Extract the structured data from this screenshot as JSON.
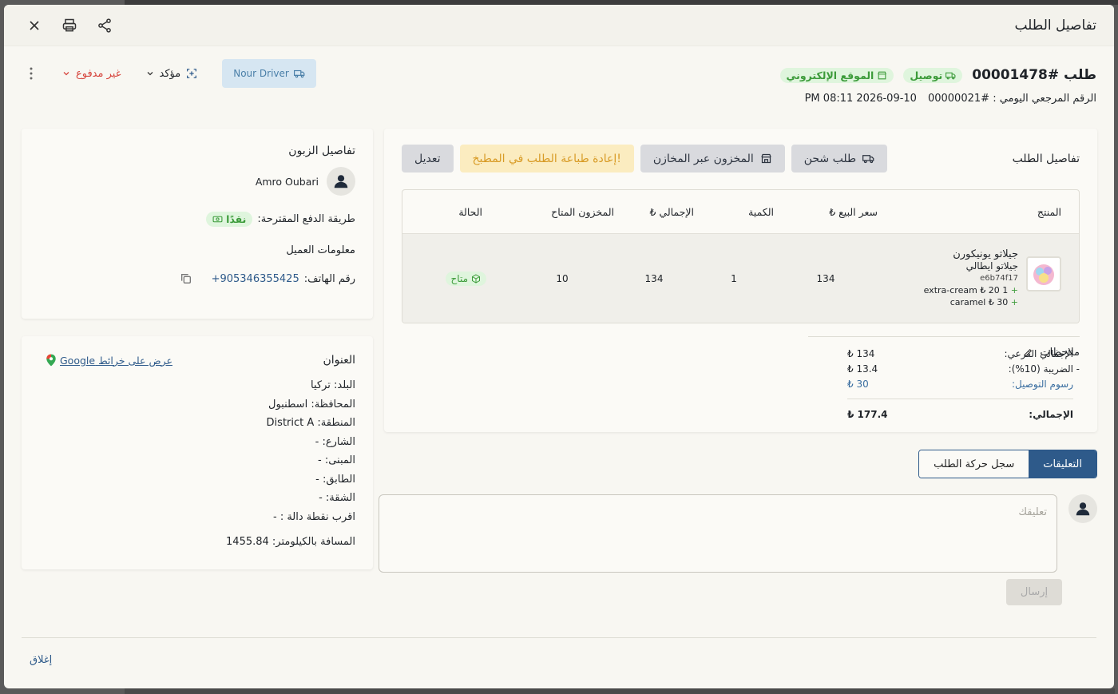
{
  "modal": {
    "title": "تفاصيل الطلب"
  },
  "order": {
    "number": "طلب #00001478",
    "badge_delivery": "توصيل",
    "badge_source": "الموقع الإلكتروني",
    "daily_ref_label": "الرقم المرجعي اليومي :",
    "daily_ref_value": "#00000021",
    "datetime": "2026-09-10 08:11 PM",
    "driver": "Nour Driver",
    "status": "مؤكد",
    "payment_status": "غير مدفوع"
  },
  "customer": {
    "section_title": "تفاصيل الزبون",
    "name": "Amro Oubari",
    "payment_label": "طريقة الدفع المقترحة:",
    "payment_value": "نقدًا",
    "info_title": "معلومات العميل",
    "phone_label": "رقم الهاتف:",
    "phone_value": "+905346355425"
  },
  "address": {
    "section_title": "العنوان",
    "map_link": "عرض على خرائط Google",
    "lines": [
      "البلد: تركيا",
      "المحافظة: اسطنبول",
      "المنطقة: District A",
      "الشارع: -",
      "المبنى: -",
      "الطابق: -",
      "الشقة: -",
      "اقرب نقطة دالة : -"
    ],
    "distance": "المسافة بالكيلومتر: 1455.84"
  },
  "order_details": {
    "section_title": "تفاصيل الطلب",
    "actions": {
      "shipping": "طلب شحن",
      "stock": "المخزون عبر المخازن",
      "reprint": "إعادة طباعة الطلب في المطبخ!",
      "edit": "تعديل"
    },
    "columns": [
      "المنتج",
      "سعر البيع ₺",
      "الكمية",
      "الإجمالي ₺",
      "المخزون المتاح",
      "الحالة"
    ],
    "items": [
      {
        "name": "جيلاتو يونيكورن",
        "category": "جيلاتو ايطالي",
        "code": "e6b74f17",
        "addons": [
          "1 extra-cream ₺ 20",
          "caramel ₺ 30"
        ],
        "price": "134",
        "qty": "1",
        "total": "134",
        "stock": "10",
        "status": "متاح"
      }
    ],
    "notes_title": "ملاحظات",
    "notes_value": "-",
    "summary": {
      "subtotal_label": "الإجمالي الفرعي:",
      "subtotal_value": "₺ 134",
      "tax_label": "الضريبة (10%):",
      "tax_value": "₺ 13.4",
      "delivery_label": "رسوم التوصيل:",
      "delivery_value": "₺ 30",
      "total_label": "الإجمالي:",
      "total_value": "₺ 177.4"
    }
  },
  "tabs": {
    "comments": "التعليقات",
    "history": "سجل حركة الطلب"
  },
  "comment": {
    "placeholder": "تعليقك",
    "send": "إرسال"
  },
  "footer": {
    "close": "إغلاق"
  },
  "colors": {
    "primary": "#2e5a8a",
    "success": "#3c9b3a",
    "danger": "#d6453d",
    "warning": "#d89b26"
  }
}
